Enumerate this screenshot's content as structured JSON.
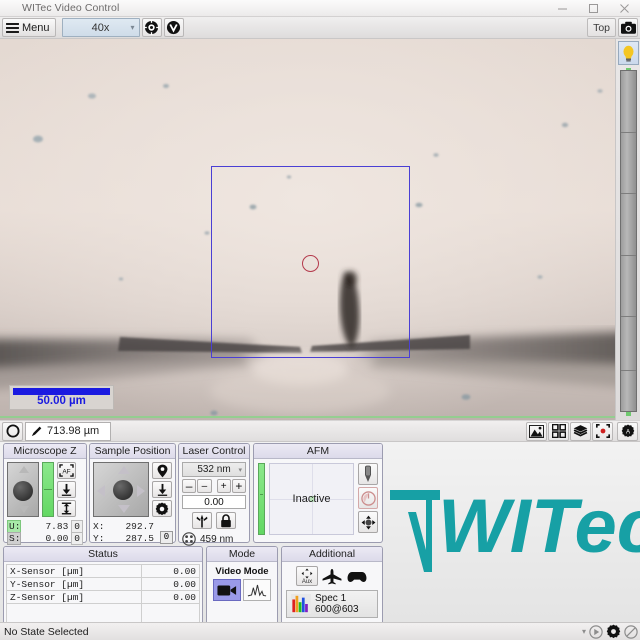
{
  "window": {
    "title": "WITec Video Control",
    "minimize": "minimize-button",
    "maximize": "maximize-button",
    "close": "close-button"
  },
  "toolbar": {
    "menu_label": "Menu",
    "objective_value": "40x",
    "objective_caret": "▾",
    "focus_icon": "target-icon",
    "video_icon": "v-circle-icon",
    "top_label": "Top",
    "camera_icon": "camera-icon"
  },
  "video": {
    "scalebar_label": "50.00 µm",
    "roi_name": "scan-region-rectangle",
    "spot_name": "laser-spot-marker",
    "bulb_icon": "lightbulb-icon",
    "brightness_slider": "illumination-slider"
  },
  "strip": {
    "circle_icon": "circle-icon",
    "pen_icon": "pen-icon",
    "distance_value": "713.98 µm",
    "icons": [
      "image-icon",
      "grid-icon",
      "layers-icon",
      "focus-target-icon",
      "settings-gear-icon"
    ]
  },
  "panels": {
    "microscope_z": {
      "title": "Microscope Z",
      "btn_af": "AF",
      "btn_down": "move-down-icon",
      "btn_range": "range-icon",
      "rows": [
        {
          "key": "U:",
          "value": "7.83",
          "unit": "0"
        },
        {
          "key": "S:",
          "value": "0.00",
          "unit": "0"
        }
      ]
    },
    "sample_position": {
      "title": "Sample Position",
      "btn_marker": "map-pin-icon",
      "btn_down": "move-down-icon",
      "btn_settings": "gear-icon",
      "rows": [
        {
          "key": "X:",
          "value": "292.7"
        },
        {
          "key": "Y:",
          "value": "287.5"
        }
      ],
      "zero_button": "0"
    },
    "laser_control": {
      "title": "Laser Control",
      "wavelength": "532 nm",
      "caret": "▾",
      "dec_big": "–",
      "dec_small": "–",
      "inc_small": "+",
      "inc_big": "+",
      "power_value": "0.00",
      "btn_laser": "laser-burst-icon",
      "btn_lock": "lock-icon",
      "spot_icon": "crosshair-circle-icon",
      "spot_value": "459 nm"
    },
    "afm": {
      "title": "AFM",
      "state": "Inactive",
      "btn_tip": "tip-approach-icon",
      "btn_gauge": "gauge-icon",
      "btn_move": "move-arrows-icon"
    },
    "status": {
      "title": "Status",
      "rows": [
        {
          "label": "X-Sensor [µm]",
          "value": "0.00"
        },
        {
          "label": "Y-Sensor [µm]",
          "value": "0.00"
        },
        {
          "label": "Z-Sensor [µm]",
          "value": "0.00"
        }
      ]
    },
    "mode": {
      "title": "Mode",
      "label": "Video Mode",
      "btn_video": "video-camera-icon",
      "btn_spectrum": "spectrum-peak-icon"
    },
    "additional": {
      "title": "Additional",
      "btn_aux": "Aux",
      "btn_aux_icon": "aux-arrows-icon",
      "btn_plane": "airplane-icon",
      "btn_gamepad": "gamepad-icon",
      "spec_icon": "spectrum-bars-icon",
      "spec_line1": "Spec 1",
      "spec_line2": "600@603"
    }
  },
  "brand": {
    "logo_text": "WITec",
    "logo_color": "#17a0a5"
  },
  "statusbar": {
    "state_text": "No State Selected",
    "caret": "▾",
    "play_icon": "play-icon",
    "gear_icon": "gear-icon",
    "block_icon": "no-entry-icon"
  }
}
